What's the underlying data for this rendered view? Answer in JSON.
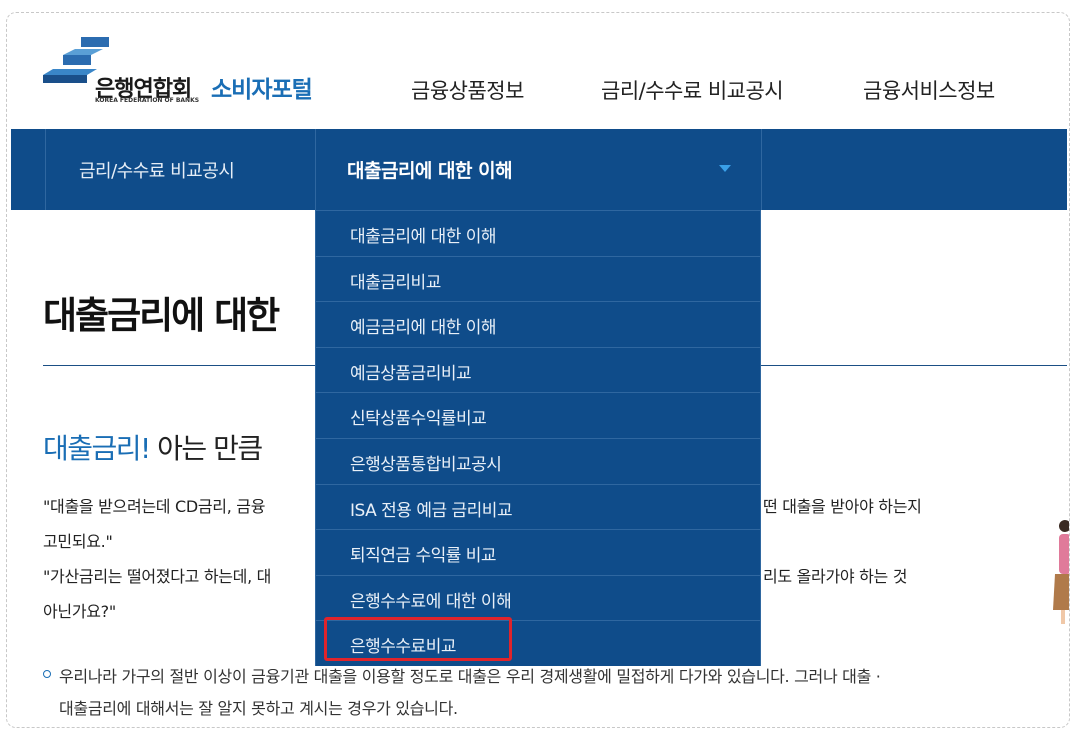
{
  "logo": {
    "name_ko": "은행연합회",
    "name_en": "KOREA FEDERATION OF BANKS",
    "portal": "소비자포털"
  },
  "gnb": [
    "금융상품정보",
    "금리/수수료 비교공시",
    "금융서비스정보"
  ],
  "subbar": {
    "left_label": "금리/수수료 비교공시",
    "current_label": "대출금리에 대한 이해"
  },
  "dropdown": {
    "items": [
      "대출금리에 대한 이해",
      "대출금리비교",
      "예금금리에 대한 이해",
      "예금상품금리비교",
      "신탁상품수익률비교",
      "은행상품통합비교공시",
      "ISA 전용 예금 금리비교",
      "퇴직연금 수익률 비교",
      "은행수수료에 대한 이해",
      "은행수수료비교"
    ],
    "highlighted_index": 9,
    "highlight_color": "#e0242b"
  },
  "content": {
    "page_title": "대출금리에 대한",
    "section_title_highlight": "대출금리!",
    "section_title_rest": " 아는 만큼",
    "quote_line1_left": "\"대출을 받으려는데 CD금리, 금융",
    "quote_line1_right": "떤 대출을 받아야 하는지",
    "quote_line2": "고민되요.\"",
    "quote_line3_left": "\"가산금리는 떨어졌다고 하는데, 대",
    "quote_line3_right": "리도 올라가야 하는 것",
    "quote_line4": "아닌가요?\"",
    "bullet_line1": "우리나라 가구의 절반 이상이 금융기관 대출을 이용할 정도로 대출은 우리 경제생활에 밀접하게 다가와 있습니다. 그러나 대출 ·",
    "bullet_line2": "대출금리에 대해서는 잘 알지 못하고 계시는 경우가 있습니다."
  },
  "colors": {
    "brand_blue": "#0f4c8a",
    "accent_blue": "#1a6eb5"
  }
}
